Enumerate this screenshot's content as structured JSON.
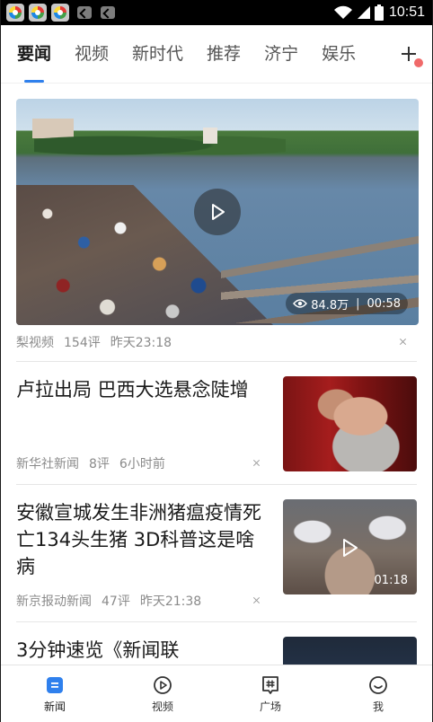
{
  "status_bar": {
    "time": "10:51"
  },
  "tabs": {
    "items": [
      {
        "label": "要闻",
        "active": true
      },
      {
        "label": "视频",
        "active": false
      },
      {
        "label": "新时代",
        "active": false
      },
      {
        "label": "推荐",
        "active": false
      },
      {
        "label": "济宁",
        "active": false
      },
      {
        "label": "娱乐",
        "active": false
      }
    ],
    "add_icon": "plus-icon",
    "accent": "#2f80ed",
    "badge_color": "#f06a6a"
  },
  "feed": {
    "video_card": {
      "views": "84.8万",
      "separator": "|",
      "duration": "00:58",
      "source": "梨视频",
      "comments": "154评",
      "time": "昨天23:18"
    },
    "articles": [
      {
        "title": "卢拉出局 巴西大选悬念陡增",
        "source": "新华社新闻",
        "comments": "8评",
        "time": "6小时前"
      },
      {
        "title": "安徽宣城发生非洲猪瘟疫情死亡134头生猪 3D科普这是啥病",
        "source": "新京报动新闻",
        "comments": "47评",
        "time": "昨天21:38",
        "duration": "01:18"
      },
      {
        "title": "3分钟速览《新闻联"
      }
    ]
  },
  "bottom_nav": {
    "items": [
      {
        "label": "新闻",
        "icon": "news-icon",
        "active": true
      },
      {
        "label": "视频",
        "icon": "video-play-icon",
        "active": false
      },
      {
        "label": "广场",
        "icon": "square-hashtag-icon",
        "active": false
      },
      {
        "label": "我",
        "icon": "smiley-profile-icon",
        "active": false
      }
    ],
    "active_color": "#2f80ed"
  }
}
